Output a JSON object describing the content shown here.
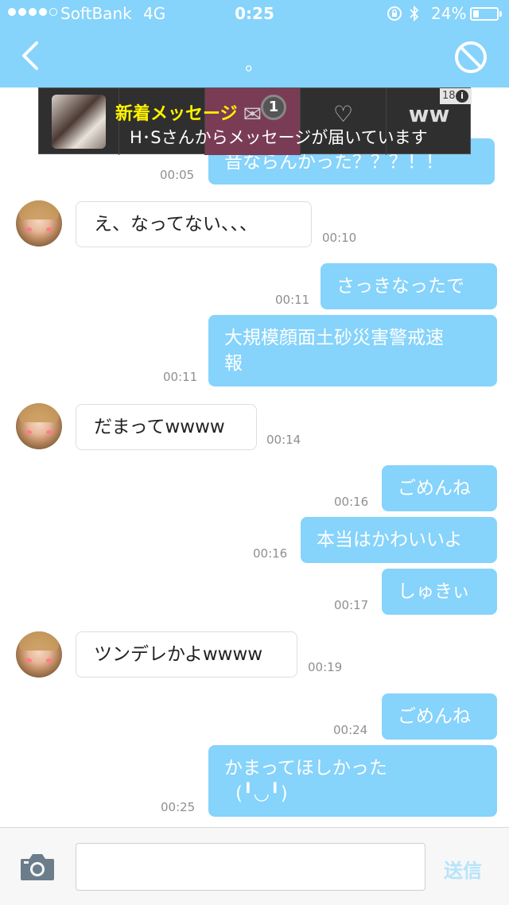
{
  "status_bar": {
    "carrier": "SoftBank",
    "network": "4G",
    "time": "0:25",
    "battery_percent": "24%",
    "battery_level": 0.24,
    "signal_dots_filled": 4,
    "signal_dots_total": 5
  },
  "nav": {
    "title": "。",
    "back_icon": "chevron-left-icon",
    "block_icon": "block-icon"
  },
  "ad": {
    "title": "新着メッセージ",
    "subtitle": "H･Sさんからメッセージが届いています",
    "badge": "1",
    "rating": "18",
    "info": "i",
    "ww": "ww"
  },
  "messages": [
    {
      "side": "out",
      "text": "音ならんかった？？？！！",
      "time": "00:05"
    },
    {
      "side": "in",
      "text": "え、なってない、、、",
      "time": "00:10"
    },
    {
      "side": "out",
      "text": "さっきなったで",
      "time": "00:11"
    },
    {
      "side": "out",
      "text_line1": "大規模顔面土砂災害警戒速",
      "text_line2": "報",
      "time": "00:11"
    },
    {
      "side": "in",
      "text": "だまってwwww",
      "time": "00:14"
    },
    {
      "side": "out",
      "text": "ごめんね",
      "time": "00:16"
    },
    {
      "side": "out",
      "text": "本当はかわいいよ",
      "time": "00:16"
    },
    {
      "side": "out",
      "text": "しゅきぃ",
      "time": "00:17"
    },
    {
      "side": "in",
      "text": "ツンデレかよwwww",
      "time": "00:19"
    },
    {
      "side": "out",
      "text": "ごめんね",
      "time": "00:24"
    },
    {
      "side": "out",
      "text_line1": "かまってほしかった",
      "text_line2": "(╹◡╹)",
      "time": "00:25"
    }
  ],
  "input": {
    "placeholder": "",
    "value": "",
    "send_label": "送信",
    "camera_icon": "camera-icon"
  },
  "colors": {
    "accent": "#86d3fb",
    "outgoing_bubble": "#86d3fb",
    "send_disabled": "#b7e3fb",
    "ad_title": "#fff200"
  }
}
